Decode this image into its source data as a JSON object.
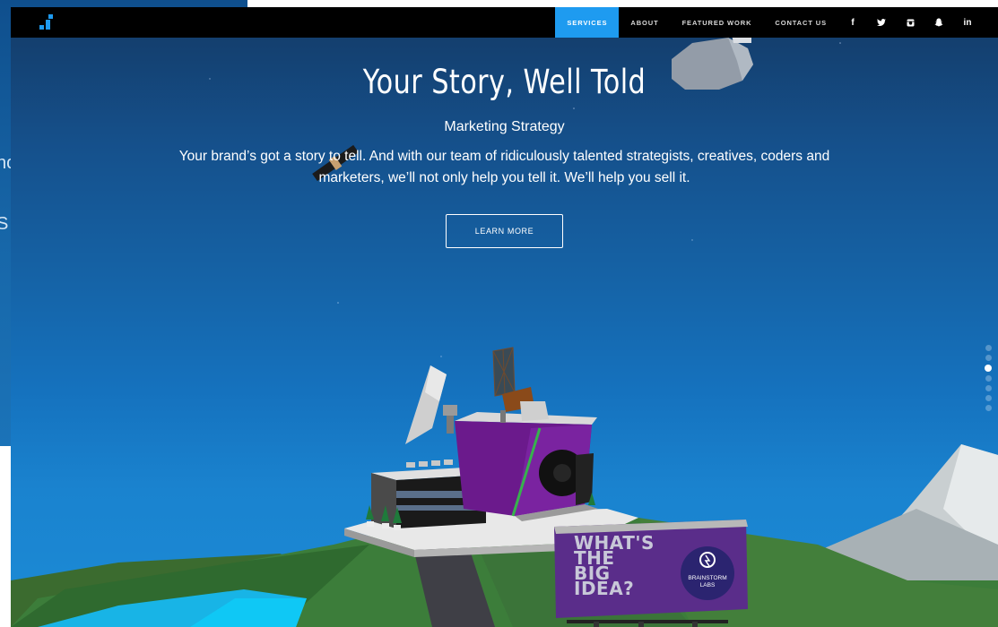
{
  "ghost": {
    "fragment_1": "nc",
    "fragment_2": "S"
  },
  "nav": {
    "items": [
      {
        "label": "SERVICES",
        "active": true
      },
      {
        "label": "ABOUT",
        "active": false
      },
      {
        "label": "FEATURED WORK",
        "active": false
      },
      {
        "label": "CONTACT US",
        "active": false
      }
    ],
    "social": [
      {
        "icon": "facebook-icon",
        "glyph": "f"
      },
      {
        "icon": "twitter-icon",
        "glyph": "🐦"
      },
      {
        "icon": "instagram-icon",
        "glyph": "◙"
      },
      {
        "icon": "snapchat-icon",
        "glyph": "👻"
      },
      {
        "icon": "linkedin-icon",
        "glyph": "in"
      }
    ]
  },
  "hero": {
    "title": "Your Story, Well Told",
    "subtitle": "Marketing Strategy",
    "body": "Your brand’s got a story to tell. And with our team of ridiculously talented strategists, creatives, coders and marketers, we’ll not only help you tell it. We’ll help you sell it.",
    "cta": "LEARN MORE"
  },
  "billboard": {
    "headline_1": "WHAT'S",
    "headline_2": "THE",
    "headline_3": "BIG",
    "headline_4": "IDEA?",
    "logo_1": "BRAINSTORM",
    "logo_2": "LABS"
  },
  "page_dots": {
    "count": 7,
    "active_index": 2
  },
  "colors": {
    "accent": "#1e9bf0",
    "nav_bg": "#000000",
    "sky_top": "#143a66",
    "sky_bottom": "#1c8bd6",
    "building_purple": "#6b1a8c"
  }
}
